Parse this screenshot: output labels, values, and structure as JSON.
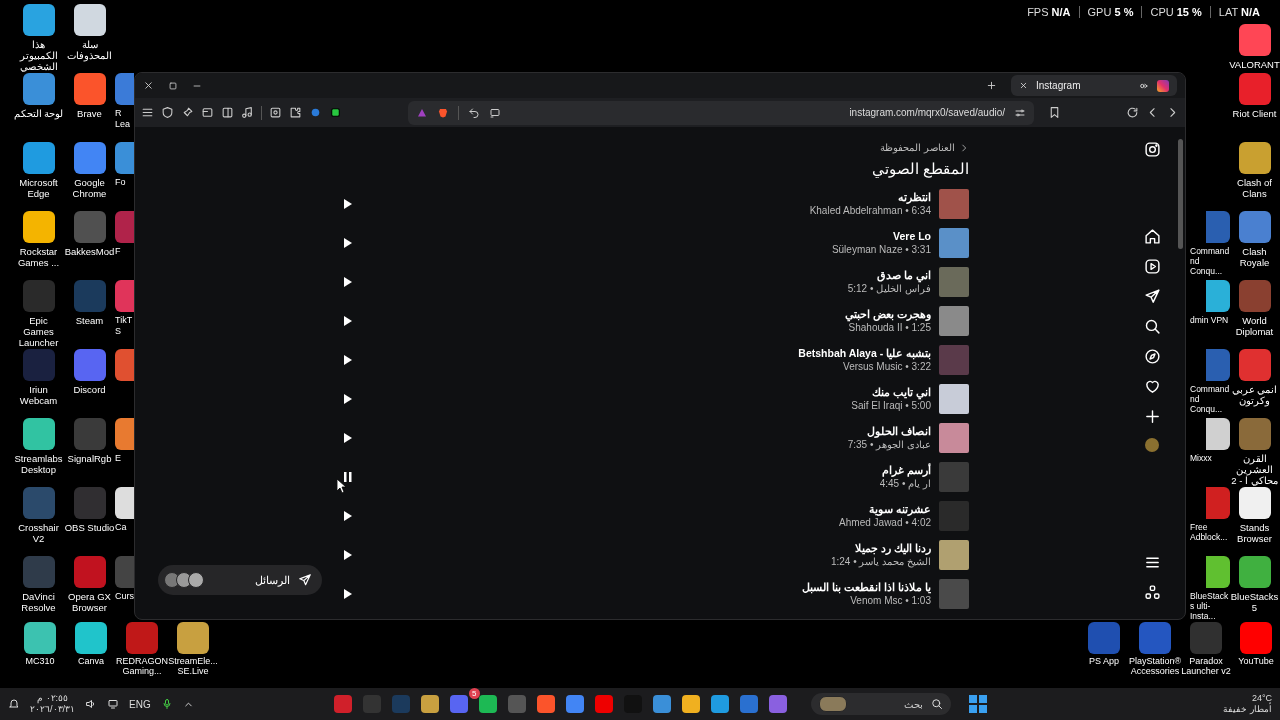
{
  "overlay": {
    "stats": [
      {
        "label": "FPS",
        "value": "N/A"
      },
      {
        "label": "GPU",
        "value": "5 %"
      },
      {
        "label": "CPU",
        "value": "15 %"
      },
      {
        "label": "LAT",
        "value": "N/A"
      }
    ]
  },
  "desktop": {
    "left_columns": [
      [
        {
          "label": "هذا الكمبيوتر الشخصي",
          "color": "#29a3e0"
        },
        {
          "label": "لوحة التحكم",
          "color": "#3a8fd8"
        },
        {
          "label": "Microsoft Edge",
          "color": "#1f9be0"
        },
        {
          "label": "Rockstar Games ...",
          "color": "#f4b400"
        },
        {
          "label": "Epic Games Launcher",
          "color": "#2a2a2a"
        },
        {
          "label": "Iriun Webcam",
          "color": "#1a2140"
        },
        {
          "label": "Streamlabs Desktop",
          "color": "#31c3a2"
        },
        {
          "label": "Crosshair V2",
          "color": "#2b4a6b"
        },
        {
          "label": "DaVinci Resolve",
          "color": "#2f3b4a"
        },
        {
          "label": "MC310",
          "color": "#3cc2b0"
        }
      ],
      [
        {
          "label": "سلة المحذوفات",
          "color": "#d0d8e0"
        },
        {
          "label": "Brave",
          "color": "#fb542b"
        },
        {
          "label": "Google Chrome",
          "color": "#4285f4"
        },
        {
          "label": "BakkesMod",
          "color": "#505050"
        },
        {
          "label": "Steam",
          "color": "#1b3a5c"
        },
        {
          "label": "Discord",
          "color": "#5865f2"
        },
        {
          "label": "SignalRgb",
          "color": "#3a3a3a"
        },
        {
          "label": "OBS Studio",
          "color": "#302e31"
        },
        {
          "label": "Opera GX Browser",
          "color": "#c1121f"
        },
        {
          "label": "Canva",
          "color": "#20c4cb"
        }
      ],
      [
        null,
        {
          "label": "R Lea",
          "color": "#3b7bd8"
        },
        {
          "label": "Fo",
          "color": "#3a8fd8"
        },
        {
          "label": "F",
          "color": "#b0234a"
        },
        {
          "label": "TikT S",
          "color": "#e0345a"
        },
        {
          "color": "#e05030"
        },
        {
          "label": "E",
          "color": "#e87a30"
        },
        {
          "label": "Ca",
          "color": "#dddddd"
        },
        {
          "label": "Curs",
          "color": "#444444"
        },
        {
          "label": "REDRAGON Gaming...",
          "color": "#c01818"
        }
      ],
      [
        null,
        null,
        null,
        null,
        null,
        null,
        null,
        null,
        null,
        {
          "label": "StreamEle... SE.Live",
          "color": "#c8a040"
        }
      ]
    ],
    "right_columns": [
      [
        null,
        null,
        null,
        null,
        null,
        null,
        null,
        null,
        null,
        {
          "label": "PS App",
          "color": "#1f4fb0"
        }
      ],
      [
        null,
        null,
        null,
        null,
        null,
        null,
        null,
        null,
        null,
        {
          "label": "PlayStation® Accessories",
          "color": "#2456c0"
        }
      ],
      [
        null,
        null,
        null,
        {
          "label": "Command nd Conqu...",
          "color": "#2a5fb0"
        },
        {
          "label": "dmin VPN",
          "color": "#2ab0d8"
        },
        {
          "label": "Command nd Conqu...",
          "color": "#2a5fb0"
        },
        {
          "label": "Mixxx",
          "color": "#d0d0d0"
        },
        {
          "label": "Free Adblock...",
          "color": "#d02020"
        },
        {
          "label": "BlueStacks ulti-Insta...",
          "color": "#60c030"
        },
        {
          "label": "Paradox Launcher v2",
          "color": "#303030"
        }
      ],
      [
        {
          "label": "VALORANT",
          "color": "#ff4655"
        },
        {
          "label": "Riot Client",
          "color": "#e8202a"
        },
        {
          "label": "Clash of Clans",
          "color": "#c9a030"
        },
        {
          "label": "Clash Royale",
          "color": "#4a80d0"
        },
        {
          "label": "World Diplomat",
          "color": "#8a4030"
        },
        {
          "label": "انمي عربي وكرتون",
          "color": "#e03030"
        },
        {
          "label": "القرن العشرين محاكي ا - 2",
          "color": "#8a6a3a"
        },
        {
          "label": "Stands Browser",
          "color": "#f0f0f0"
        },
        {
          "label": "BlueStacks 5",
          "color": "#40b040"
        },
        {
          "label": "YouTube",
          "color": "#ff0000"
        }
      ]
    ]
  },
  "browser": {
    "tab": {
      "title": "Instagram"
    },
    "url": "instagram.com/mqrx0/saved/audio/",
    "page": {
      "breadcrumb": "العناصر المحفوظة",
      "title": "المقطع الصوتي",
      "tracks": [
        {
          "title": "انتظرته",
          "subtitle": "Khaled Abdelrahman • 6:34",
          "playing": false,
          "color": "#a0524a"
        },
        {
          "title": "Vere Lo",
          "subtitle": "Süleyman Naze • 3:31",
          "playing": false,
          "color": "#5a90c8"
        },
        {
          "title": "اني ما صدق",
          "subtitle": "فراس الخليل • 5:12",
          "playing": false,
          "color": "#6a6a5a"
        },
        {
          "title": "وهجرت بعض احبتي",
          "subtitle": "Shahouda II • 1:25",
          "playing": false,
          "color": "#8a8a8a"
        },
        {
          "title": "Betshbah Alaya - بتشبه عليا",
          "subtitle": "Versus Music • 3:22",
          "playing": false,
          "color": "#5a3a4a"
        },
        {
          "title": "اني تايب منك",
          "subtitle": "Saif El Iraqi • 5:00",
          "playing": false,
          "color": "#c8ccd8"
        },
        {
          "title": "انصاف الحلول",
          "subtitle": "عبادى الجوهر • 7:35",
          "playing": false,
          "color": "#c88a9a"
        },
        {
          "title": "أرسم غرام",
          "subtitle": "ار يام • 4:45",
          "playing": true,
          "color": "#3a3a3a"
        },
        {
          "title": "عشرتنه سوية",
          "subtitle": "Ahmed Jawad • 4:02",
          "playing": false,
          "color": "#2a2a2a"
        },
        {
          "title": "ردنا اليك رد جميلا",
          "subtitle": "الشيخ محمد ياسر • 1:24",
          "playing": false,
          "color": "#b0a070"
        },
        {
          "title": "يا ملاذنا اذا انقطعت بنا السبل",
          "subtitle": "Venom Msc • 1:03",
          "playing": false,
          "color": "#4a4a4a"
        }
      ],
      "messages": {
        "label": "الرسائل"
      }
    }
  },
  "taskbar": {
    "time": "٠٢:٥٥ م",
    "date": "٢٠٢٦/٠٣/٣١",
    "language": "ENG",
    "search": {
      "placeholder": "بحث"
    },
    "discord_badge": "5",
    "weather": {
      "temperature": "24°C",
      "condition": "أمطار خفيفة"
    }
  }
}
